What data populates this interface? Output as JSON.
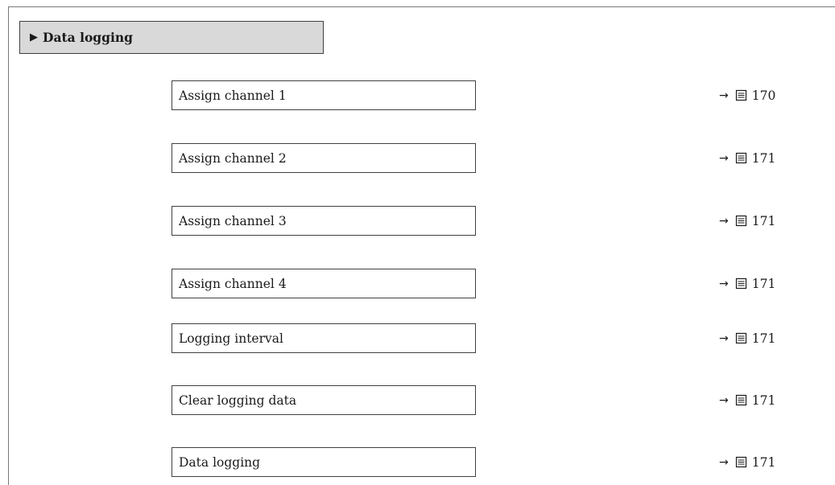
{
  "menu": {
    "title": "Data logging",
    "marker": "▶"
  },
  "parameters": [
    {
      "label": "Assign channel 1",
      "arrow": "→",
      "page": "170"
    },
    {
      "label": "Assign channel 2",
      "arrow": "→",
      "page": "171"
    },
    {
      "label": "Assign channel 3",
      "arrow": "→",
      "page": "171"
    },
    {
      "label": "Assign channel 4",
      "arrow": "→",
      "page": "171"
    },
    {
      "label": "Logging interval",
      "arrow": "→",
      "page": "171"
    },
    {
      "label": "Clear logging data",
      "arrow": "→",
      "page": "171"
    },
    {
      "label": "Data logging",
      "arrow": "→",
      "page": "171"
    }
  ],
  "icons": {
    "page_reference": "book-icon"
  }
}
